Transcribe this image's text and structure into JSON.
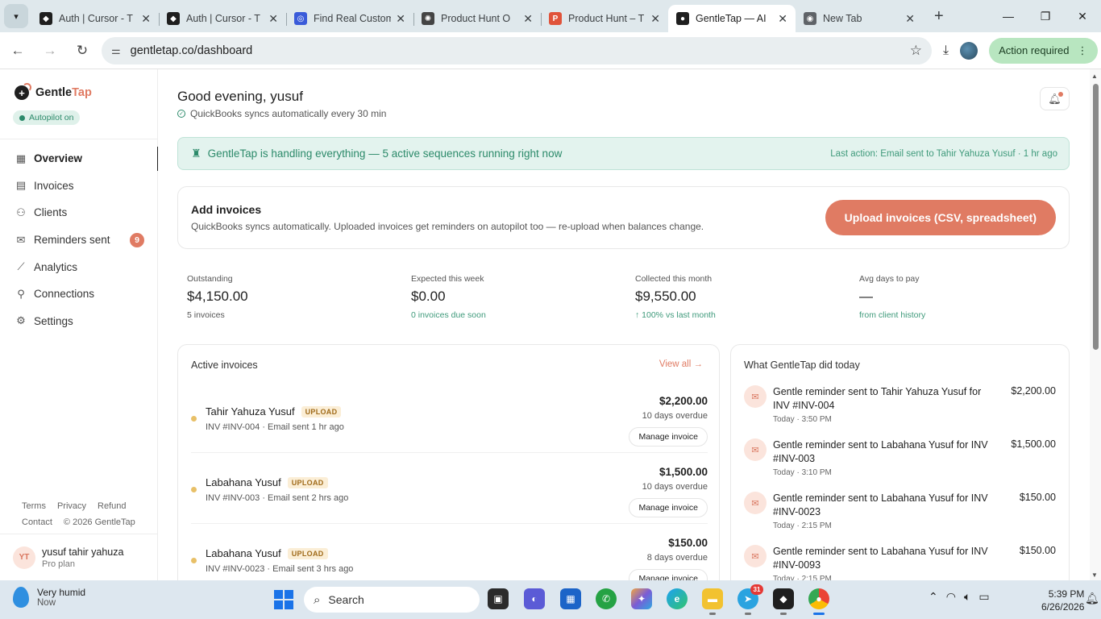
{
  "browser": {
    "tabs": [
      {
        "title": "Auth | Cursor - T",
        "icon": "cursor-logo-icon",
        "color": "#1f1f1f",
        "glyph": "◆"
      },
      {
        "title": "Auth | Cursor - T",
        "icon": "cursor-logo-icon",
        "color": "#1f1f1f",
        "glyph": "◆"
      },
      {
        "title": "Find Real Custom",
        "icon": "target-icon",
        "color": "#3a5bd9",
        "glyph": "◎"
      },
      {
        "title": "Product Hunt O",
        "icon": "openai-icon",
        "color": "#444444",
        "glyph": "✺"
      },
      {
        "title": "Product Hunt – T",
        "icon": "product-hunt-icon",
        "color": "#e0533a",
        "glyph": "P"
      },
      {
        "title": "GentleTap — AI",
        "icon": "gentletap-icon",
        "color": "#1f1f1f",
        "glyph": "●"
      },
      {
        "title": "New Tab",
        "icon": "chrome-icon",
        "color": "#5f6368",
        "glyph": "◉"
      }
    ],
    "active_tab": 5,
    "url": "gentletap.co/dashboard",
    "action_required": "Action required"
  },
  "sidebar": {
    "brand_dark": "Gentle",
    "brand_accent": "Tap",
    "autopilot": "Autopilot on",
    "nav": [
      {
        "label": "Overview",
        "icon": "grid-icon",
        "glyph": "▦",
        "active": true
      },
      {
        "label": "Invoices",
        "icon": "document-icon",
        "glyph": "▤"
      },
      {
        "label": "Clients",
        "icon": "users-icon",
        "glyph": "⚇"
      },
      {
        "label": "Reminders sent",
        "icon": "mail-icon",
        "glyph": "✉",
        "badge": "9"
      },
      {
        "label": "Analytics",
        "icon": "trend-icon",
        "glyph": "⟋"
      },
      {
        "label": "Connections",
        "icon": "plug-icon",
        "glyph": "⚲"
      },
      {
        "label": "Settings",
        "icon": "gear-icon",
        "glyph": "⚙"
      }
    ],
    "links": {
      "terms": "Terms",
      "privacy": "Privacy",
      "refund": "Refund",
      "contact": "Contact",
      "copyright": "© 2026 GentleTap"
    },
    "user": {
      "initials": "YT",
      "name": "yusuf tahir yahuza",
      "plan": "Pro plan"
    }
  },
  "header": {
    "greeting": "Good evening, yusuf",
    "sync_note": "QuickBooks syncs automatically every 30 min"
  },
  "banner": {
    "text": "GentleTap is handling everything — 5 active sequences running right now",
    "last_action": "Last action: Email sent to Tahir Yahuza Yusuf · 1 hr ago"
  },
  "add_invoices": {
    "title": "Add invoices",
    "subtitle": "QuickBooks syncs automatically. Uploaded invoices get reminders on autopilot too — re-upload when balances change.",
    "button": "Upload invoices (CSV, spreadsheet)"
  },
  "stats": [
    {
      "label": "Outstanding",
      "value": "$4,150.00",
      "note": "5 invoices",
      "green": false
    },
    {
      "label": "Expected this week",
      "value": "$0.00",
      "note": "0 invoices due soon",
      "green": true
    },
    {
      "label": "Collected this month",
      "value": "$9,550.00",
      "note": "↑ 100% vs last month",
      "green": true
    },
    {
      "label": "Avg days to pay",
      "value": "—",
      "note": "from client history",
      "green": true
    }
  ],
  "active_invoices": {
    "title": "Active invoices",
    "view_all": "View all →",
    "rows": [
      {
        "name": "Tahir Yahuza Yusuf",
        "tag": "UPLOAD",
        "meta": "INV #INV-004 · Email sent 1 hr ago",
        "amount": "$2,200.00",
        "overdue": "10 days overdue",
        "button": "Manage invoice"
      },
      {
        "name": "Labahana Yusuf",
        "tag": "UPLOAD",
        "meta": "INV #INV-003 · Email sent 2 hrs ago",
        "amount": "$1,500.00",
        "overdue": "10 days overdue",
        "button": "Manage invoice"
      },
      {
        "name": "Labahana Yusuf",
        "tag": "UPLOAD",
        "meta": "INV #INV-0023 · Email sent 3 hrs ago",
        "amount": "$150.00",
        "overdue": "8 days overdue",
        "button": "Manage invoice"
      }
    ]
  },
  "today": {
    "title": "What GentleTap did today",
    "items": [
      {
        "text": "Gentle reminder sent to Tahir Yahuza Yusuf for INV #INV-004",
        "time": "Today · 3:50 PM",
        "amount": "$2,200.00"
      },
      {
        "text": "Gentle reminder sent to Labahana Yusuf for INV #INV-003",
        "time": "Today · 3:10 PM",
        "amount": "$1,500.00"
      },
      {
        "text": "Gentle reminder sent to Labahana Yusuf for INV #INV-0023",
        "time": "Today · 2:15 PM",
        "amount": "$150.00"
      },
      {
        "text": "Gentle reminder sent to Labahana Yusuf for INV #INV-0093",
        "time": "Today · 2:15 PM",
        "amount": "$150.00"
      }
    ]
  },
  "taskbar": {
    "weather_title": "Very humid",
    "weather_sub": "Now",
    "search": "Search",
    "telegram_badge": "31",
    "time": "5:39 PM",
    "date": "6/26/2026"
  },
  "colors": {
    "accent": "#e07b63",
    "green": "#2c8a6a",
    "banner_bg": "#e3f3ee",
    "action_required_bg": "#b8e6c0"
  }
}
